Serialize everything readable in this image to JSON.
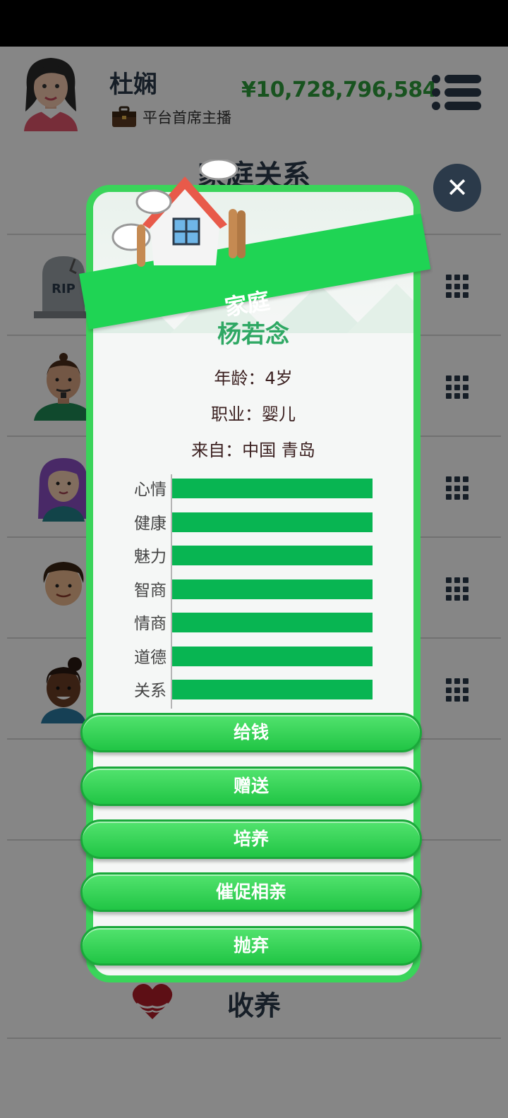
{
  "header": {
    "name": "杜娴",
    "job": "平台首席主播",
    "money": "¥10,728,796,584"
  },
  "page": {
    "title": "家庭关系"
  },
  "modal": {
    "banner": "家庭",
    "person_name": "杨若念",
    "age_line": "年龄：4岁",
    "job_line": "职业：婴儿",
    "from_line": "来自：中国 青岛",
    "stats": [
      {
        "label": "心情",
        "value": 1.0
      },
      {
        "label": "健康",
        "value": 1.0
      },
      {
        "label": "魅力",
        "value": 1.0
      },
      {
        "label": "智商",
        "value": 1.0
      },
      {
        "label": "情商",
        "value": 1.0
      },
      {
        "label": "道德",
        "value": 1.0
      },
      {
        "label": "关系",
        "value": 1.0
      }
    ],
    "actions": [
      "给钱",
      "赠送",
      "培养",
      "催促相亲",
      "抛弃"
    ]
  },
  "rows": [
    {
      "icon": "tombstone-icon",
      "tomb_text": "RIP"
    },
    {
      "icon": "avatar-man-icon"
    },
    {
      "icon": "avatar-purple-hair-woman-icon"
    },
    {
      "icon": "avatar-boy-icon"
    },
    {
      "icon": "avatar-girl-icon"
    }
  ],
  "adopt": {
    "label": "收养"
  },
  "colors": {
    "accent": "#3ad45a",
    "money": "#2e9e3c",
    "stat_bar": "#08b552",
    "dark": "#2b3a4a"
  }
}
